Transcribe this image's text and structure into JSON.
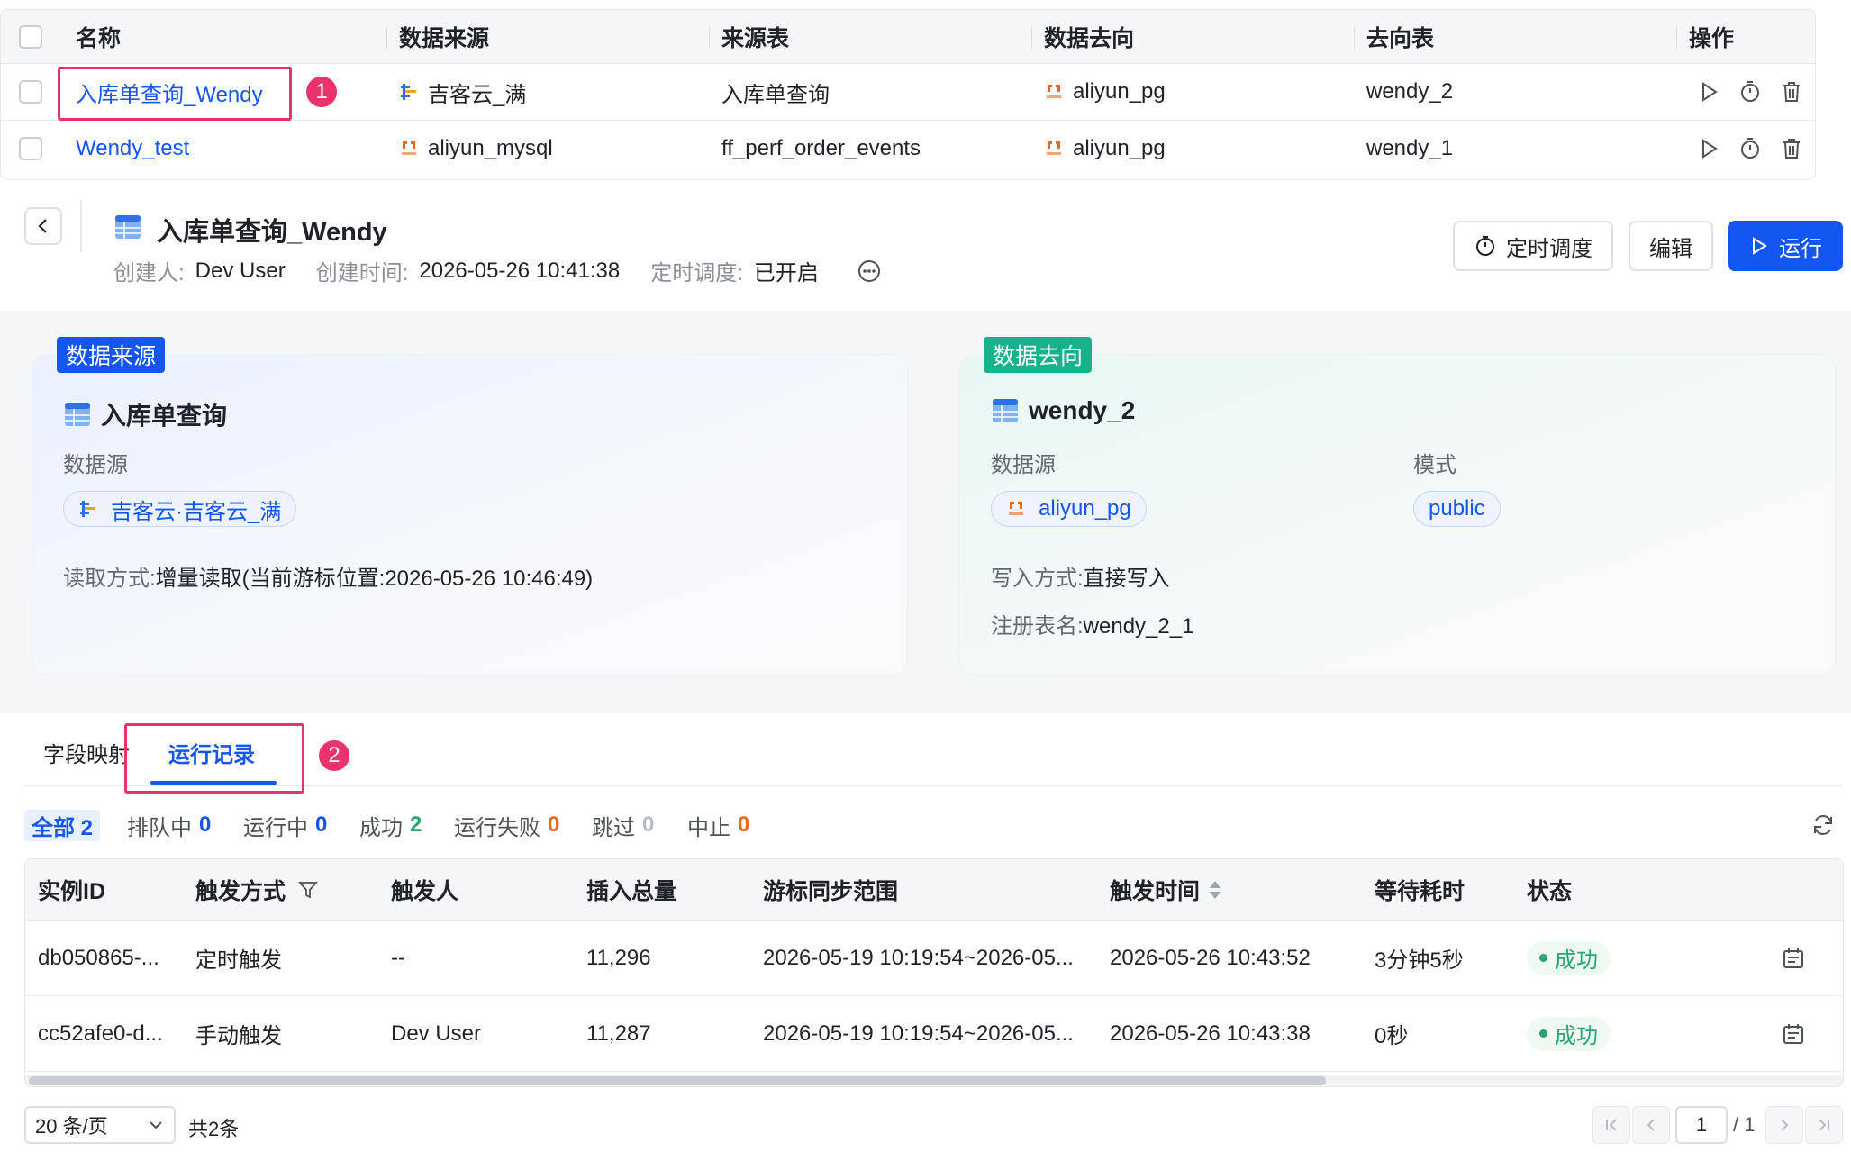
{
  "list": {
    "headers": [
      "名称",
      "数据来源",
      "来源表",
      "数据去向",
      "去向表",
      "操作"
    ],
    "rows": [
      {
        "name": "入库单查询_Wendy",
        "source": "吉客云_满",
        "source_table": "入库单查询",
        "dest": "aliyun_pg",
        "dest_table": "wendy_2"
      },
      {
        "name": "Wendy_test",
        "source": "aliyun_mysql",
        "source_table": "ff_perf_order_events",
        "dest": "aliyun_pg",
        "dest_table": "wendy_1"
      }
    ]
  },
  "annotations": {
    "one": "1",
    "two": "2"
  },
  "detail": {
    "title": "入库单查询_Wendy",
    "creator_label": "创建人:",
    "creator": "Dev User",
    "created_label": "创建时间:",
    "created": "2026-05-26 10:41:38",
    "schedule_label": "定时调度:",
    "schedule": "已开启",
    "btn_schedule": "定时调度",
    "btn_edit": "编辑",
    "btn_run": "运行"
  },
  "source_card": {
    "tag": "数据来源",
    "title": "入库单查询",
    "ds_label": "数据源",
    "ds_value": "吉客云·吉客云_满",
    "read_label": "读取方式:",
    "read_value": "增量读取(当前游标位置:2026-05-26 10:46:49)"
  },
  "dest_card": {
    "tag": "数据去向",
    "title": "wendy_2",
    "ds_label": "数据源",
    "ds_value": "aliyun_pg",
    "schema_label": "模式",
    "schema_value": "public",
    "write_label": "写入方式:",
    "write_value": "直接写入",
    "reg_label": "注册表名:",
    "reg_value": "wendy_2_1"
  },
  "tabs": {
    "mapping": "字段映射",
    "records": "运行记录"
  },
  "filters": {
    "all": "全部",
    "all_n": "2",
    "queued": "排队中",
    "queued_n": "0",
    "running": "运行中",
    "running_n": "0",
    "success": "成功",
    "success_n": "2",
    "failed": "运行失败",
    "failed_n": "0",
    "skipped": "跳过",
    "skipped_n": "0",
    "aborted": "中止",
    "aborted_n": "0"
  },
  "runs": {
    "headers": [
      "实例ID",
      "触发方式",
      "触发人",
      "插入总量",
      "游标同步范围",
      "触发时间",
      "等待耗时",
      "状态"
    ],
    "rows": [
      {
        "id": "db050865-...",
        "trigger": "定时触发",
        "by": "--",
        "total": "11,296",
        "range": "2026-05-19 10:19:54~2026-05...",
        "time": "2026-05-26 10:43:52",
        "wait": "3分钟5秒",
        "status": "成功"
      },
      {
        "id": "cc52afe0-d...",
        "trigger": "手动触发",
        "by": "Dev User",
        "total": "11,287",
        "range": "2026-05-19 10:19:54~2026-05...",
        "time": "2026-05-26 10:43:38",
        "wait": "0秒",
        "status": "成功"
      }
    ]
  },
  "pagination": {
    "page_size": "20 条/页",
    "total": "共2条",
    "page": "1",
    "pages": "/ 1"
  },
  "colors": {
    "primary": "#1456f0",
    "highlight": "#e8336b",
    "success": "#2ba471",
    "dest_tag": "#17b28c"
  }
}
